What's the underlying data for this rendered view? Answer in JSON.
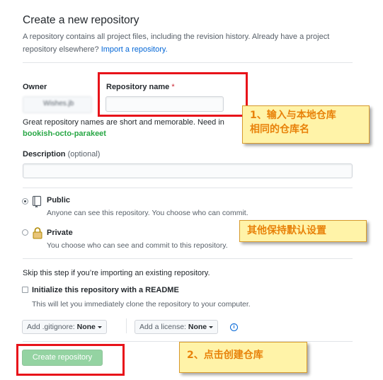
{
  "header": {
    "title": "Create a new repository",
    "subtitle": "A repository contains all project files, including the revision history. Already have a project repository elsewhere?",
    "import_link": "Import a repository."
  },
  "owner": {
    "label": "Owner",
    "value": "Wishes.jb"
  },
  "repo_name": {
    "label": "Repository name",
    "required_mark": "*",
    "value": ""
  },
  "hint": {
    "text": "Great repository names are short and memorable. Need in",
    "suggestion": "bookish-octo-parakeet"
  },
  "description": {
    "label": "Description",
    "optional": "(optional)",
    "value": ""
  },
  "visibility": {
    "public": {
      "title": "Public",
      "desc": "Anyone can see this repository. You choose who can commit.",
      "checked": true
    },
    "private": {
      "title": "Private",
      "desc": "You choose who can see and commit to this repository.",
      "checked": false
    }
  },
  "init": {
    "skip_text": "Skip this step if you’re importing an existing repository.",
    "readme_label": "Initialize this repository with a README",
    "readme_desc": "This will let you immediately clone the repository to your computer.",
    "gitignore_prefix": "Add .gitignore:",
    "gitignore_value": "None",
    "license_prefix": "Add a license:",
    "license_value": "None",
    "info_glyph": "i"
  },
  "create_button": "Create repository",
  "annotations": {
    "note1_line1": "1、输入与本地仓库",
    "note1_line2": "相同的仓库名",
    "note2": "其他保持默认设置",
    "note3": "2、点击创建仓库"
  },
  "colors": {
    "annotation_red": "#e8131a",
    "note_bg": "#fff3a8",
    "note_text": "#e8820a",
    "button_green": "#94d3a2"
  }
}
